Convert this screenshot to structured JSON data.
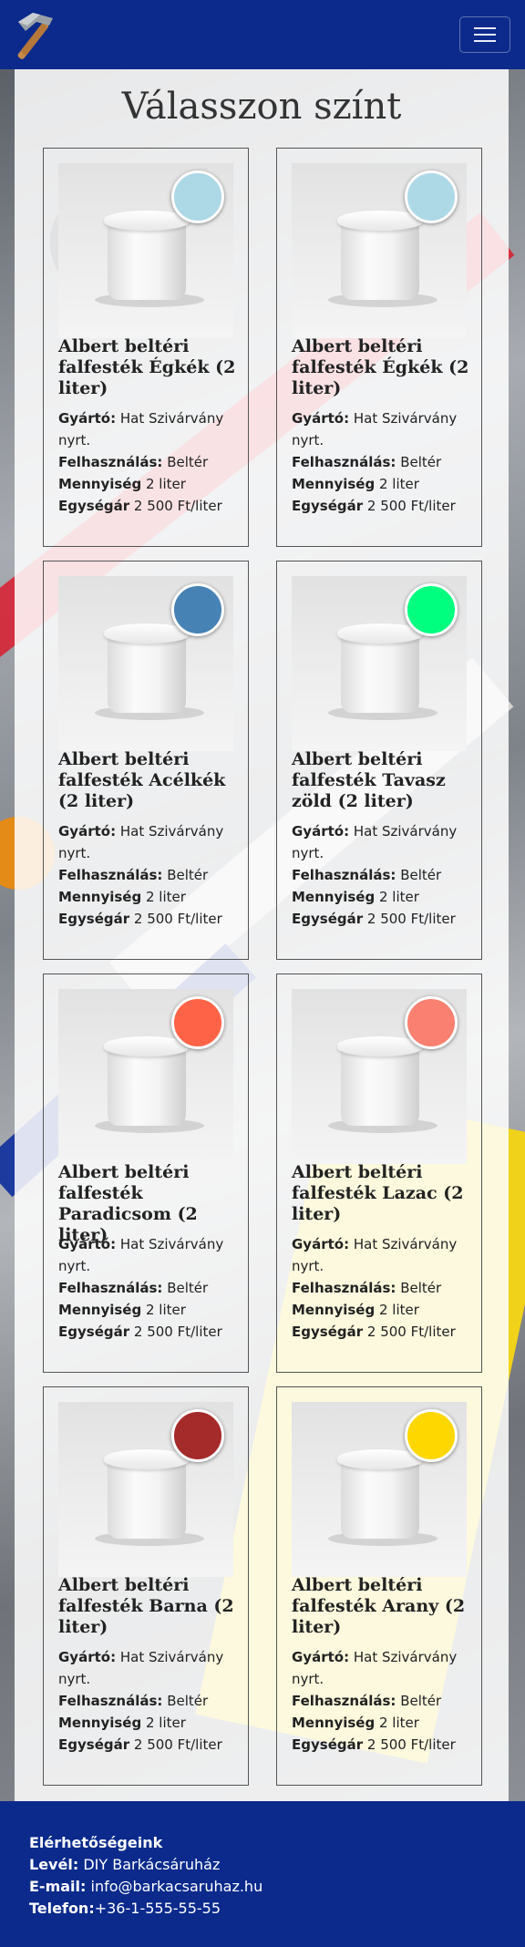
{
  "header": {
    "logo_icon": "hammer-icon",
    "menu_icon": "hamburger-menu-icon"
  },
  "page": {
    "title": "Válasszon színt"
  },
  "labels": {
    "manufacturer": "Gyártó:",
    "usage": "Felhasználás:",
    "quantity": "Mennyiség",
    "unit_price": "Egységár"
  },
  "products": [
    {
      "name": "Albert beltéri falfesték Égkék (2 liter)",
      "manufacturer": "Hat Szivárvány nyrt.",
      "usage": "Beltér",
      "quantity": "2 liter",
      "unit_price": "2 500 Ft/liter",
      "color": "#add8e6"
    },
    {
      "name": "Albert beltéri falfesték Égkék (2 liter)",
      "manufacturer": "Hat Szivárvány nyrt.",
      "usage": "Beltér",
      "quantity": "2 liter",
      "unit_price": "2 500 Ft/liter",
      "color": "#add8e6"
    },
    {
      "name": "Albert beltéri falfesték Acélkék (2 liter)",
      "manufacturer": "Hat Szivárvány nyrt.",
      "usage": "Beltér",
      "quantity": "2 liter",
      "unit_price": "2 500 Ft/liter",
      "color": "#4682b4"
    },
    {
      "name": "Albert beltéri falfesték Tavasz zöld (2 liter)",
      "manufacturer": "Hat Szivárvány nyrt.",
      "usage": "Beltér",
      "quantity": "2 liter",
      "unit_price": "2 500 Ft/liter",
      "color": "#00ff7f"
    },
    {
      "name": "Albert beltéri falfesték Paradicsom (2 liter)",
      "manufacturer": "Hat Szivárvány nyrt.",
      "usage": "Beltér",
      "quantity": "2 liter",
      "unit_price": "2 500 Ft/liter",
      "color": "#ff6347"
    },
    {
      "name": "Albert beltéri falfesték Lazac (2 liter)",
      "manufacturer": "Hat Szivárvány nyrt.",
      "usage": "Beltér",
      "quantity": "2 liter",
      "unit_price": "2 500 Ft/liter",
      "color": "#fa8072"
    },
    {
      "name": "Albert beltéri falfesték Barna (2 liter)",
      "manufacturer": "Hat Szivárvány nyrt.",
      "usage": "Beltér",
      "quantity": "2 liter",
      "unit_price": "2 500 Ft/liter",
      "color": "#a52a2a"
    },
    {
      "name": "Albert beltéri falfesték Arany (2 liter)",
      "manufacturer": "Hat Szivárvány nyrt.",
      "usage": "Beltér",
      "quantity": "2 liter",
      "unit_price": "2 500 Ft/liter",
      "color": "#ffd700"
    }
  ],
  "footer": {
    "title": "Elérhetőségeink",
    "mail_label": "Levél:",
    "mail_value": "DIY Barkácsáruház",
    "email_label": "E-mail:",
    "email_value": "info@barkacsaruhaz.hu",
    "phone_label": "Telefon:",
    "phone_value": "+36-1-555-55-55"
  },
  "colors": {
    "header_bg": "#0b2a8c",
    "footer_bg": "#0b2a8c"
  }
}
